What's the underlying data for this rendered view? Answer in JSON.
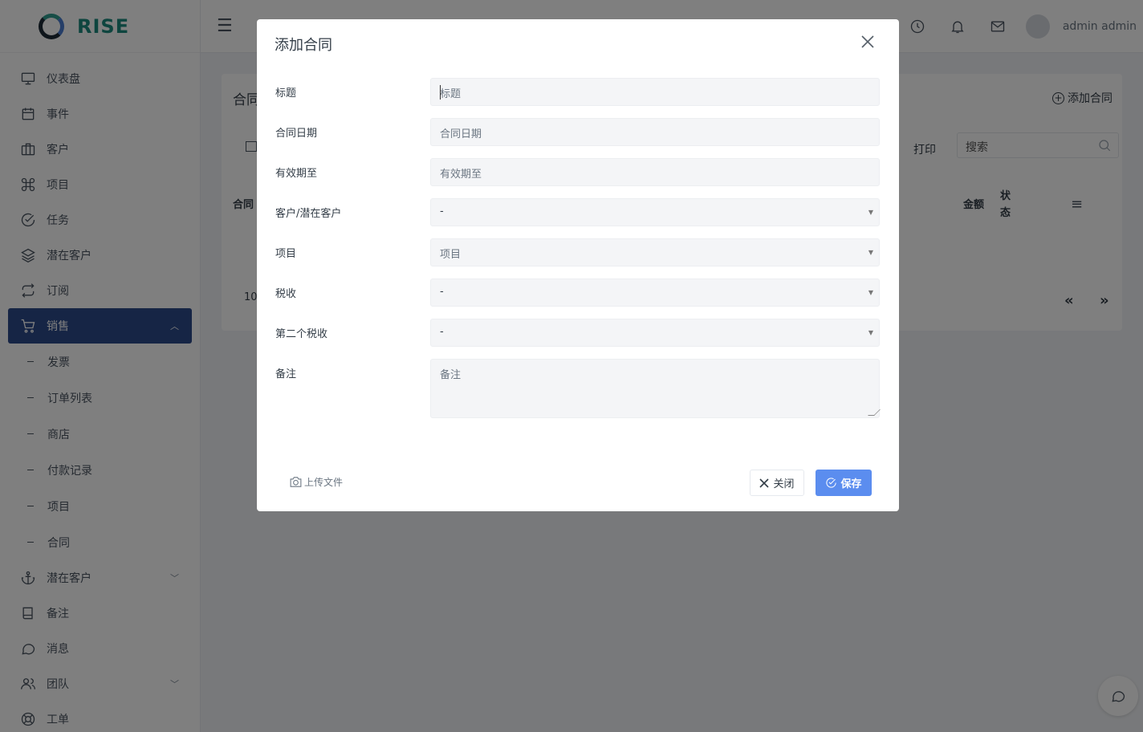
{
  "app": {
    "brand": "RISE",
    "user_name": "admin admin"
  },
  "sidebar": {
    "items": [
      {
        "label": "仪表盘",
        "icon": "monitor-icon"
      },
      {
        "label": "事件",
        "icon": "calendar-icon"
      },
      {
        "label": "客户",
        "icon": "briefcase-icon"
      },
      {
        "label": "项目",
        "icon": "command-icon"
      },
      {
        "label": "任务",
        "icon": "check-circle-icon"
      },
      {
        "label": "潜在客户",
        "icon": "layers-icon"
      },
      {
        "label": "订阅",
        "icon": "repeat-icon"
      },
      {
        "label": "销售",
        "icon": "cart-icon"
      }
    ],
    "sales_sub": [
      "发票",
      "订单列表",
      "商店",
      "付款记录",
      "项目",
      "合同"
    ],
    "items_after": [
      {
        "label": "潜在客户",
        "icon": "anchor-icon"
      },
      {
        "label": "备注",
        "icon": "book-icon"
      },
      {
        "label": "消息",
        "icon": "message-icon"
      },
      {
        "label": "团队",
        "icon": "users-icon"
      },
      {
        "label": "工单",
        "icon": "life-buoy-icon"
      }
    ]
  },
  "page": {
    "title": "合同",
    "add_button": "添加合同",
    "print": "打印",
    "search_placeholder": "搜索",
    "columns": {
      "first": "合同",
      "amount": "金额",
      "status": "状态"
    },
    "page_size": "10",
    "prev": "«",
    "next": "»"
  },
  "modal": {
    "title": "添加合同",
    "fields": {
      "title": {
        "label": "标题",
        "placeholder": "标题"
      },
      "contract_date": {
        "label": "合同日期",
        "placeholder": "合同日期"
      },
      "valid_until": {
        "label": "有效期至",
        "placeholder": "有效期至"
      },
      "client": {
        "label": "客户/潜在客户",
        "value": "-"
      },
      "project": {
        "label": "项目",
        "placeholder": "项目"
      },
      "tax": {
        "label": "税收",
        "value": "-"
      },
      "second_tax": {
        "label": "第二个税收",
        "value": "-"
      },
      "note": {
        "label": "备注",
        "placeholder": "备注"
      }
    },
    "upload": "上传文件",
    "close": "关闭",
    "save": "保存"
  },
  "colors": {
    "accent": "#5b8def",
    "sidebar_active": "#2d4a8a",
    "brand": "#1d8a7e"
  }
}
